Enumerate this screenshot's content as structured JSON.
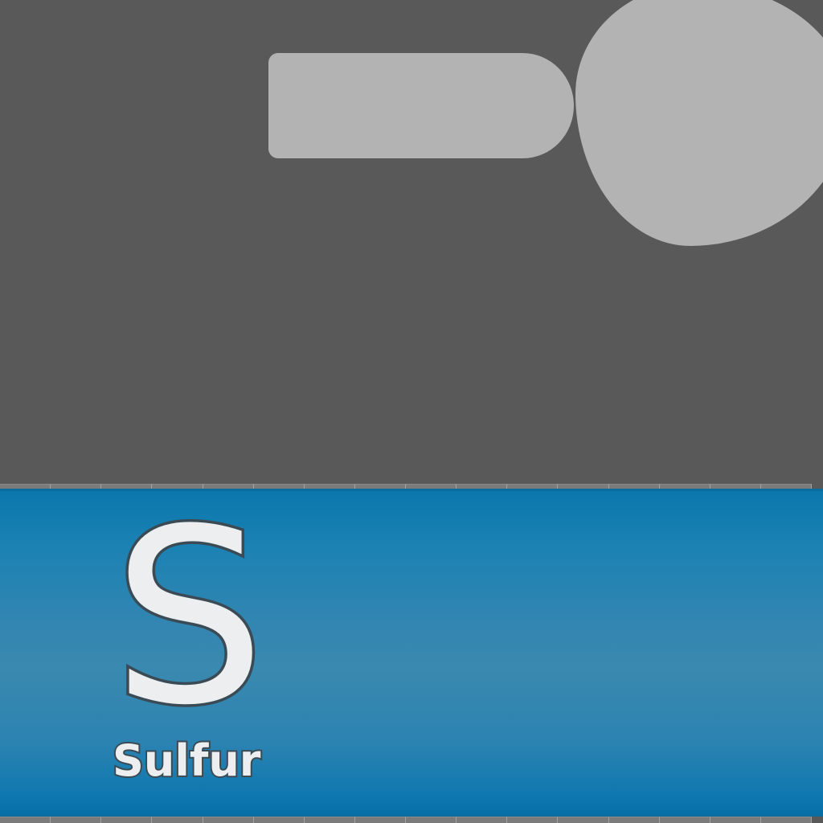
{
  "element": {
    "symbol": "S",
    "name": "Sulfur"
  },
  "colors": {
    "background": "#595959",
    "placeholder_shape": "#b3b3b3",
    "banner_blue": "#3a89b0",
    "banner_edge": "#0a77ad",
    "letter_fill": "#eceef0",
    "letter_outline": "#3a4b55"
  }
}
